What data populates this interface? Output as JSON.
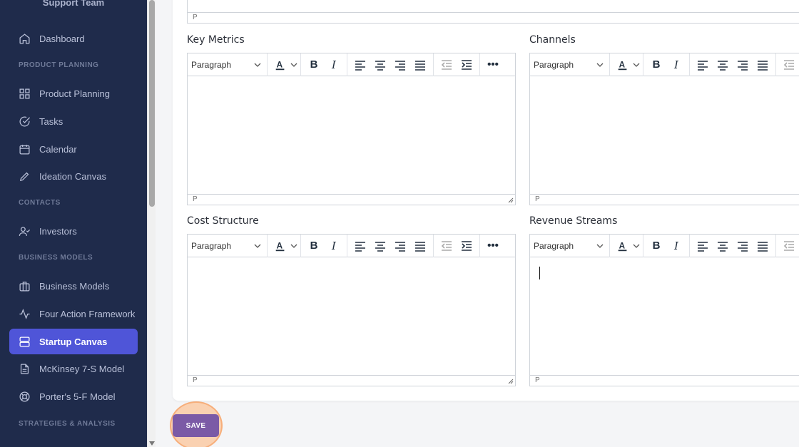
{
  "sidebar": {
    "team": "Support Team",
    "items": [
      {
        "label": "Dashboard",
        "icon": "home-icon"
      },
      {
        "section": "PRODUCT PLANNING"
      },
      {
        "label": "Product Planning",
        "icon": "grid-icon"
      },
      {
        "label": "Tasks",
        "icon": "check-circle-icon"
      },
      {
        "label": "Calendar",
        "icon": "calendar-icon"
      },
      {
        "label": "Ideation Canvas",
        "icon": "pencil-icon"
      },
      {
        "section": "CONTACTS"
      },
      {
        "label": "Investors",
        "icon": "user-check-icon"
      },
      {
        "section": "BUSINESS MODELS"
      },
      {
        "label": "Business Models",
        "icon": "briefcase-icon"
      },
      {
        "label": "Four Action Framework",
        "icon": "activity-icon"
      },
      {
        "label": "Startup Canvas",
        "icon": "server-icon",
        "active": true
      },
      {
        "label": "McKinsey 7-S Model",
        "icon": "document-icon"
      },
      {
        "label": "Porter's 5-F Model",
        "icon": "lifebuoy-icon"
      },
      {
        "section": "STRATEGIES & ANALYSIS"
      }
    ]
  },
  "editor_common": {
    "block_format": "Paragraph",
    "status_path": "P"
  },
  "fields": {
    "key_metrics": "Key Metrics",
    "channels": "Channels",
    "cost_structure": "Cost Structure",
    "revenue_streams": "Revenue Streams"
  },
  "save_label": "SAVE",
  "colors": {
    "sidebar_bg": "#1f2b4b",
    "active_item": "#4f55d8",
    "save_button": "#7b5aa6",
    "highlight": "#ffb278"
  }
}
